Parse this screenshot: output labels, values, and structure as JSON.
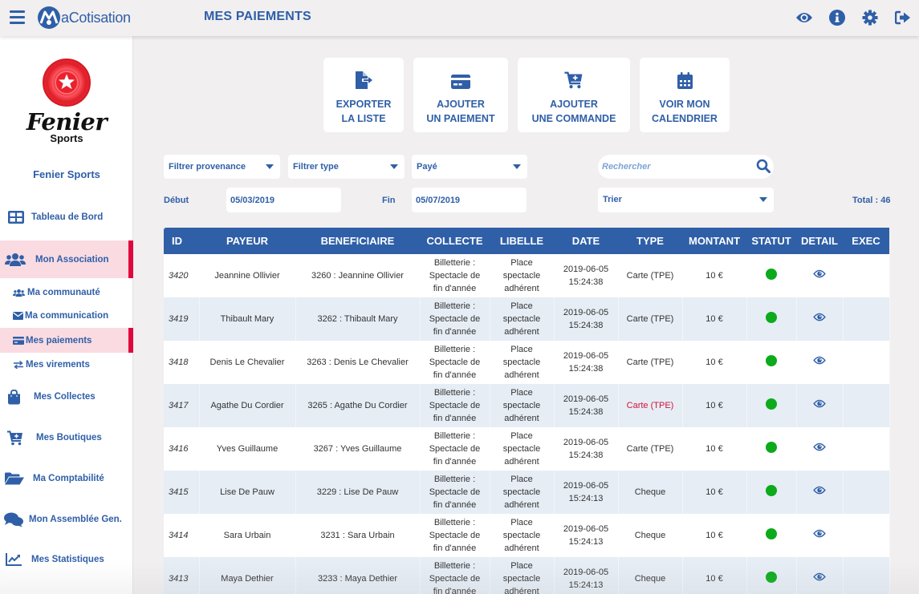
{
  "app": {
    "brand": "aCotisation",
    "page_title": "MES PAIEMENTS",
    "top_icons": [
      "eye-icon",
      "info-icon",
      "gear-icon",
      "logout-icon"
    ]
  },
  "sidebar": {
    "club_logo_title": "Fenier",
    "club_logo_subtitle": "Sports",
    "club_name": "Fenier Sports",
    "items": [
      {
        "label": "Tableau de Bord",
        "icon": "dashboard-icon",
        "active": false,
        "level": "main"
      },
      {
        "label": "Mon Association",
        "icon": "users-icon",
        "active": true,
        "level": "main"
      },
      {
        "label": "Ma communauté",
        "icon": "users-icon",
        "active": false,
        "level": "sub"
      },
      {
        "label": "Ma communication",
        "icon": "envelope-icon",
        "active": false,
        "level": "sub"
      },
      {
        "label": "Mes paiements",
        "icon": "credit-card-icon",
        "active": true,
        "level": "sub"
      },
      {
        "label": "Mes virements",
        "icon": "exchange-icon",
        "active": false,
        "level": "sub"
      },
      {
        "label": "Mes Collectes",
        "icon": "shopping-bag-icon",
        "active": false,
        "level": "main"
      },
      {
        "label": "Mes Boutiques",
        "icon": "cart-plus-icon",
        "active": false,
        "level": "main"
      },
      {
        "label": "Ma Comptabilité",
        "icon": "folder-open-icon",
        "active": false,
        "level": "main"
      },
      {
        "label": "Mon Assemblée Gen.",
        "icon": "comments-icon",
        "active": false,
        "level": "main"
      },
      {
        "label": "Mes Statistiques",
        "icon": "chart-line-icon",
        "active": false,
        "level": "main"
      }
    ]
  },
  "actions": [
    {
      "line1": "EXPORTER",
      "line2": "LA LISTE",
      "icon": "file-export-icon"
    },
    {
      "line1": "AJOUTER",
      "line2": "UN PAIEMENT",
      "icon": "credit-card-icon"
    },
    {
      "line1": "AJOUTER",
      "line2": "UNE COMMANDE",
      "icon": "cart-plus-icon"
    },
    {
      "line1": "VOIR MON",
      "line2": "CALENDRIER",
      "icon": "calendar-icon"
    }
  ],
  "filters": {
    "provenance": "Filtrer provenance",
    "type": "Filtrer type",
    "status": "Payé",
    "search_placeholder": "Rechercher",
    "debut_label": "Début",
    "debut_value": "05/03/2019",
    "fin_label": "Fin",
    "fin_value": "05/07/2019",
    "sort": "Trier",
    "total": "Total : 46"
  },
  "table": {
    "headers": [
      "ID",
      "PAYEUR",
      "BENEFICIAIRE",
      "COLLECTE",
      "LIBELLE",
      "DATE",
      "TYPE",
      "MONTANT",
      "STATUT",
      "DETAIL",
      "EXEC"
    ],
    "rows": [
      {
        "id": "3420",
        "payeur": "Jeannine  Ollivier",
        "beneficiaire": "3260 : Jeannine  Ollivier",
        "collecte": [
          "Billetterie :",
          "Spectacle de",
          "fin d'année"
        ],
        "libelle": [
          "Place",
          "spectacle",
          "adhérent"
        ],
        "date": "2019-06-05",
        "time": "15:24:38",
        "type": "Carte (TPE)",
        "type_highlight": false,
        "montant": "10 €",
        "statut": "paid"
      },
      {
        "id": "3419",
        "payeur": "Thibault  Mary",
        "beneficiaire": "3262 : Thibault  Mary",
        "collecte": [
          "Billetterie :",
          "Spectacle de",
          "fin d'année"
        ],
        "libelle": [
          "Place",
          "spectacle",
          "adhérent"
        ],
        "date": "2019-06-05",
        "time": "15:24:38",
        "type": "Carte (TPE)",
        "type_highlight": false,
        "montant": "10 €",
        "statut": "paid"
      },
      {
        "id": "3418",
        "payeur": "Denis  Le Chevalier",
        "beneficiaire": "3263 : Denis  Le Chevalier",
        "collecte": [
          "Billetterie :",
          "Spectacle de",
          "fin d'année"
        ],
        "libelle": [
          "Place",
          "spectacle",
          "adhérent"
        ],
        "date": "2019-06-05",
        "time": "15:24:38",
        "type": "Carte (TPE)",
        "type_highlight": false,
        "montant": "10 €",
        "statut": "paid"
      },
      {
        "id": "3417",
        "payeur": "Agathe  Du Cordier",
        "beneficiaire": "3265 : Agathe  Du Cordier",
        "collecte": [
          "Billetterie :",
          "Spectacle de",
          "fin d'année"
        ],
        "libelle": [
          "Place",
          "spectacle",
          "adhérent"
        ],
        "date": "2019-06-05",
        "time": "15:24:38",
        "type": "Carte (TPE)",
        "type_highlight": true,
        "montant": "10 €",
        "statut": "paid"
      },
      {
        "id": "3416",
        "payeur": "Yves  Guillaume",
        "beneficiaire": "3267 : Yves  Guillaume",
        "collecte": [
          "Billetterie :",
          "Spectacle de",
          "fin d'année"
        ],
        "libelle": [
          "Place",
          "spectacle",
          "adhérent"
        ],
        "date": "2019-06-05",
        "time": "15:24:38",
        "type": "Carte (TPE)",
        "type_highlight": false,
        "montant": "10 €",
        "statut": "paid"
      },
      {
        "id": "3415",
        "payeur": "Lise  De Pauw",
        "beneficiaire": "3229 : Lise  De Pauw",
        "collecte": [
          "Billetterie :",
          "Spectacle de",
          "fin d'année"
        ],
        "libelle": [
          "Place",
          "spectacle",
          "adhérent"
        ],
        "date": "2019-06-05",
        "time": "15:24:13",
        "type": "Cheque",
        "type_highlight": false,
        "montant": "10 €",
        "statut": "paid"
      },
      {
        "id": "3414",
        "payeur": "Sara  Urbain",
        "beneficiaire": "3231 : Sara  Urbain",
        "collecte": [
          "Billetterie :",
          "Spectacle de",
          "fin d'année"
        ],
        "libelle": [
          "Place",
          "spectacle",
          "adhérent"
        ],
        "date": "2019-06-05",
        "time": "15:24:13",
        "type": "Cheque",
        "type_highlight": false,
        "montant": "10 €",
        "statut": "paid"
      },
      {
        "id": "3413",
        "payeur": "Maya  Dethier",
        "beneficiaire": "3233 : Maya  Dethier",
        "collecte": [
          "Billetterie :",
          "Spectacle de",
          "fin d'année"
        ],
        "libelle": [
          "Place",
          "spectacle",
          "adhérent"
        ],
        "date": "2019-06-05",
        "time": "15:24:13",
        "type": "Cheque",
        "type_highlight": false,
        "montant": "10 €",
        "statut": "paid"
      }
    ]
  },
  "colors": {
    "brand_blue": "#2f5fa7",
    "active_bg": "#fadbe2",
    "active_bar": "#e0073f",
    "status_paid": "#0bab1c",
    "row_alt": "#e6edf5",
    "highlight_red": "#d5123a"
  }
}
